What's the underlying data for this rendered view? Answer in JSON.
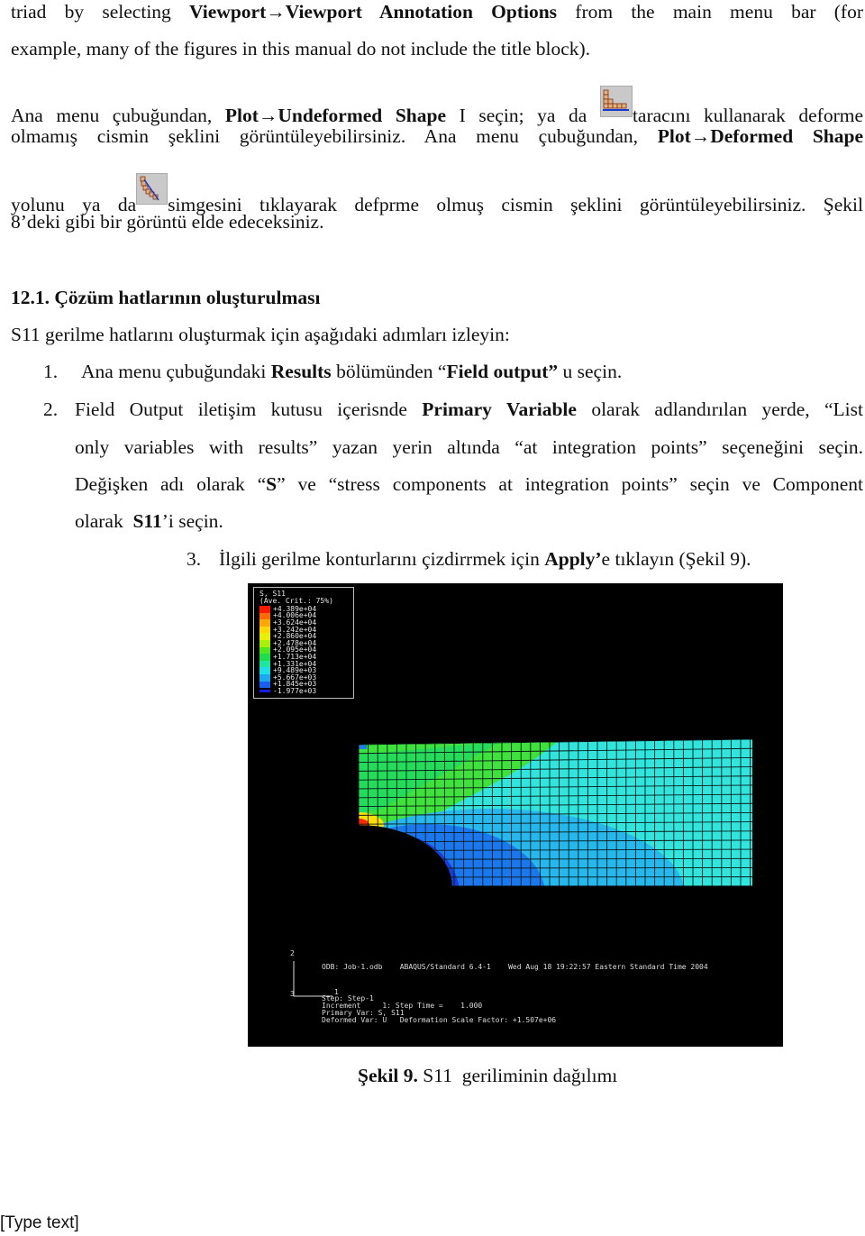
{
  "lines": {
    "l1": {
      "a": "triad by selecting ",
      "b": "Viewport→Viewport Annotation Options",
      "c": " from the main menu bar (for"
    },
    "l2": {
      "a": "example, many of the figures in this manual do not include the title block)."
    },
    "l3": {
      "a": "Ana menu çubuğundan, ",
      "b": "Plot→Undeformed Shape",
      "c": " I seçin; ya da ",
      "d": "taracını kullanarak deforme"
    },
    "l4": {
      "a": "olmamış cismin şeklini görüntüleyebilirsiniz. Ana menu çubuğundan, ",
      "b": "Plot→Deformed Shape"
    },
    "l5": {
      "a": "yolunu ya da",
      "b": "simgesini tıklayarak defprme olmuş cismin şeklini görüntüleyebilirsiniz. Şekil"
    },
    "l6": {
      "a": "8’deki gibi bir görüntü elde edeceksiniz."
    }
  },
  "section": {
    "heading": "12.1. Çözüm hatlarının oluşturulması",
    "intro": "S11 gerilme hatlarını oluşturmak için aşağıdaki adımları izleyin:"
  },
  "steps": [
    {
      "num": "1.",
      "a": "Ana menu çubuğundaki ",
      "b": "Results",
      "c": " bölümünden “",
      "d": "Field output”",
      "e": " u seçin."
    },
    {
      "num": "2.",
      "l1a": "Field Output iletişim kutusu içerisnde ",
      "l1b": "Primary Variable",
      "l1c": " olarak adlandırılan yerde, “List",
      "l2": "only variables with results” yazan yerin altında “at integration points” seçeneğini seçin.",
      "l3a": "Değişken adı olarak “",
      "l3b": "S",
      "l3c": "” ve “stress components at integration points” seçin ve Component",
      "l4a": "olarak  ",
      "l4b": "S11",
      "l4c": "’i seçin."
    },
    {
      "num": "3.",
      "a": "İlgili gerilme konturlarını çizdirrmek için ",
      "b": "Apply’",
      "c": "e tıklayın (Şekil 9)."
    }
  ],
  "icons": {
    "undeformed": "undeformed-shape-tool-icon",
    "deformed": "deformed-shape-tool-icon"
  },
  "figure": {
    "legend_title": "S, S11",
    "legend_subtitle": "(Ave. Crit.: 75%)",
    "legend_values": [
      "+4.389e+04",
      "+4.006e+04",
      "+3.624e+04",
      "+3.242e+04",
      "+2.860e+04",
      "+2.478e+04",
      "+2.095e+04",
      "+1.713e+04",
      "+1.331e+04",
      "+9.489e+03",
      "+5.667e+03",
      "+1.845e+03",
      "-1.977e+03"
    ],
    "legend_colors": [
      "#ff1a00",
      "#ff6a00",
      "#ffa800",
      "#ffd800",
      "#e8f000",
      "#a8f000",
      "#4ce81a",
      "#1ae04c",
      "#1ae8a0",
      "#1ae0e8",
      "#1aa8f0",
      "#1a60f0",
      "#1a1ae8"
    ],
    "triad_y": "2",
    "triad_x": "1",
    "triad_z": "3",
    "odb_line": "ODB: Job-1.odb    ABAQUS/Standard 6.4-1    Wed Aug 18 19:22:57 Eastern Standard Time 2004",
    "step": "Step: Step-1",
    "increment": "Increment     1: Step Time =    1.000",
    "primary_var": "Primary Var: S, S11",
    "deformed_var": "Deformed Var: U   Deformation Scale Factor: +1.507e+06"
  },
  "caption": {
    "label": "Şekil 9.",
    "text": " S11  geriliminin dağılımı"
  },
  "footer": "[Type text]"
}
